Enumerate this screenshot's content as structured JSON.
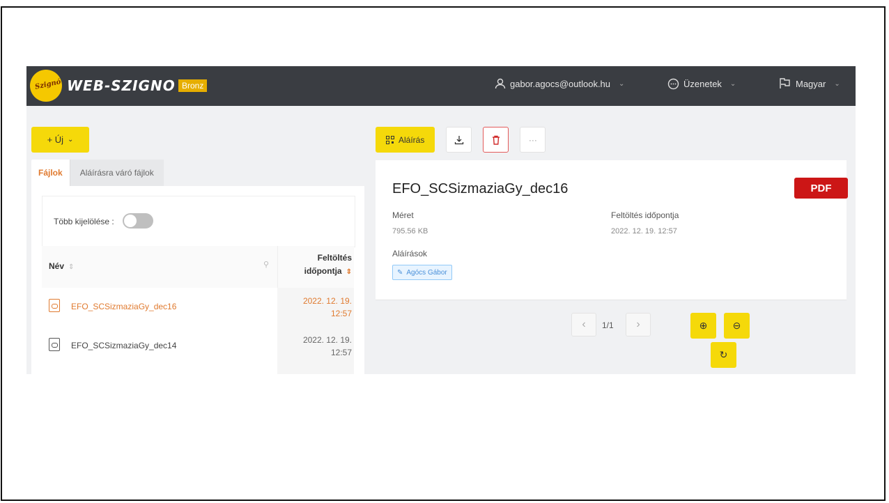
{
  "brand": {
    "name": "WEB-SZIGNO",
    "tier": "Bronz",
    "seal_text": "Szignó"
  },
  "header": {
    "user": "gabor.agocs@outlook.hu",
    "messages": "Üzenetek",
    "language": "Magyar"
  },
  "left": {
    "new_button": "+ Új",
    "tabs": [
      "Fájlok",
      "Aláírásra váró fájlok"
    ],
    "multi_select_label": "Több kijelölése :",
    "columns": {
      "name": "Név",
      "date_line1": "Feltöltés",
      "date_line2": "időpontja"
    },
    "rows": [
      {
        "name": "EFO_SCSizmaziaGy_dec16",
        "date1": "2022. 12. 19.",
        "date2": "12:57",
        "selected": true
      },
      {
        "name": "EFO_SCSizmaziaGy_dec14",
        "date1": "2022. 12. 19.",
        "date2": "12:57",
        "selected": false
      }
    ]
  },
  "right": {
    "sign_button": "Aláírás",
    "doc_title": "EFO_SCSizmaziaGy_dec16",
    "doc_type": "PDF",
    "size_label": "Méret",
    "size_value": "795.56 KB",
    "upload_label": "Feltöltés időpontja",
    "upload_value": "2022. 12. 19. 12:57",
    "signatures_label": "Aláírások",
    "signer": "Agócs Gábor",
    "page_indicator": "1/1"
  }
}
